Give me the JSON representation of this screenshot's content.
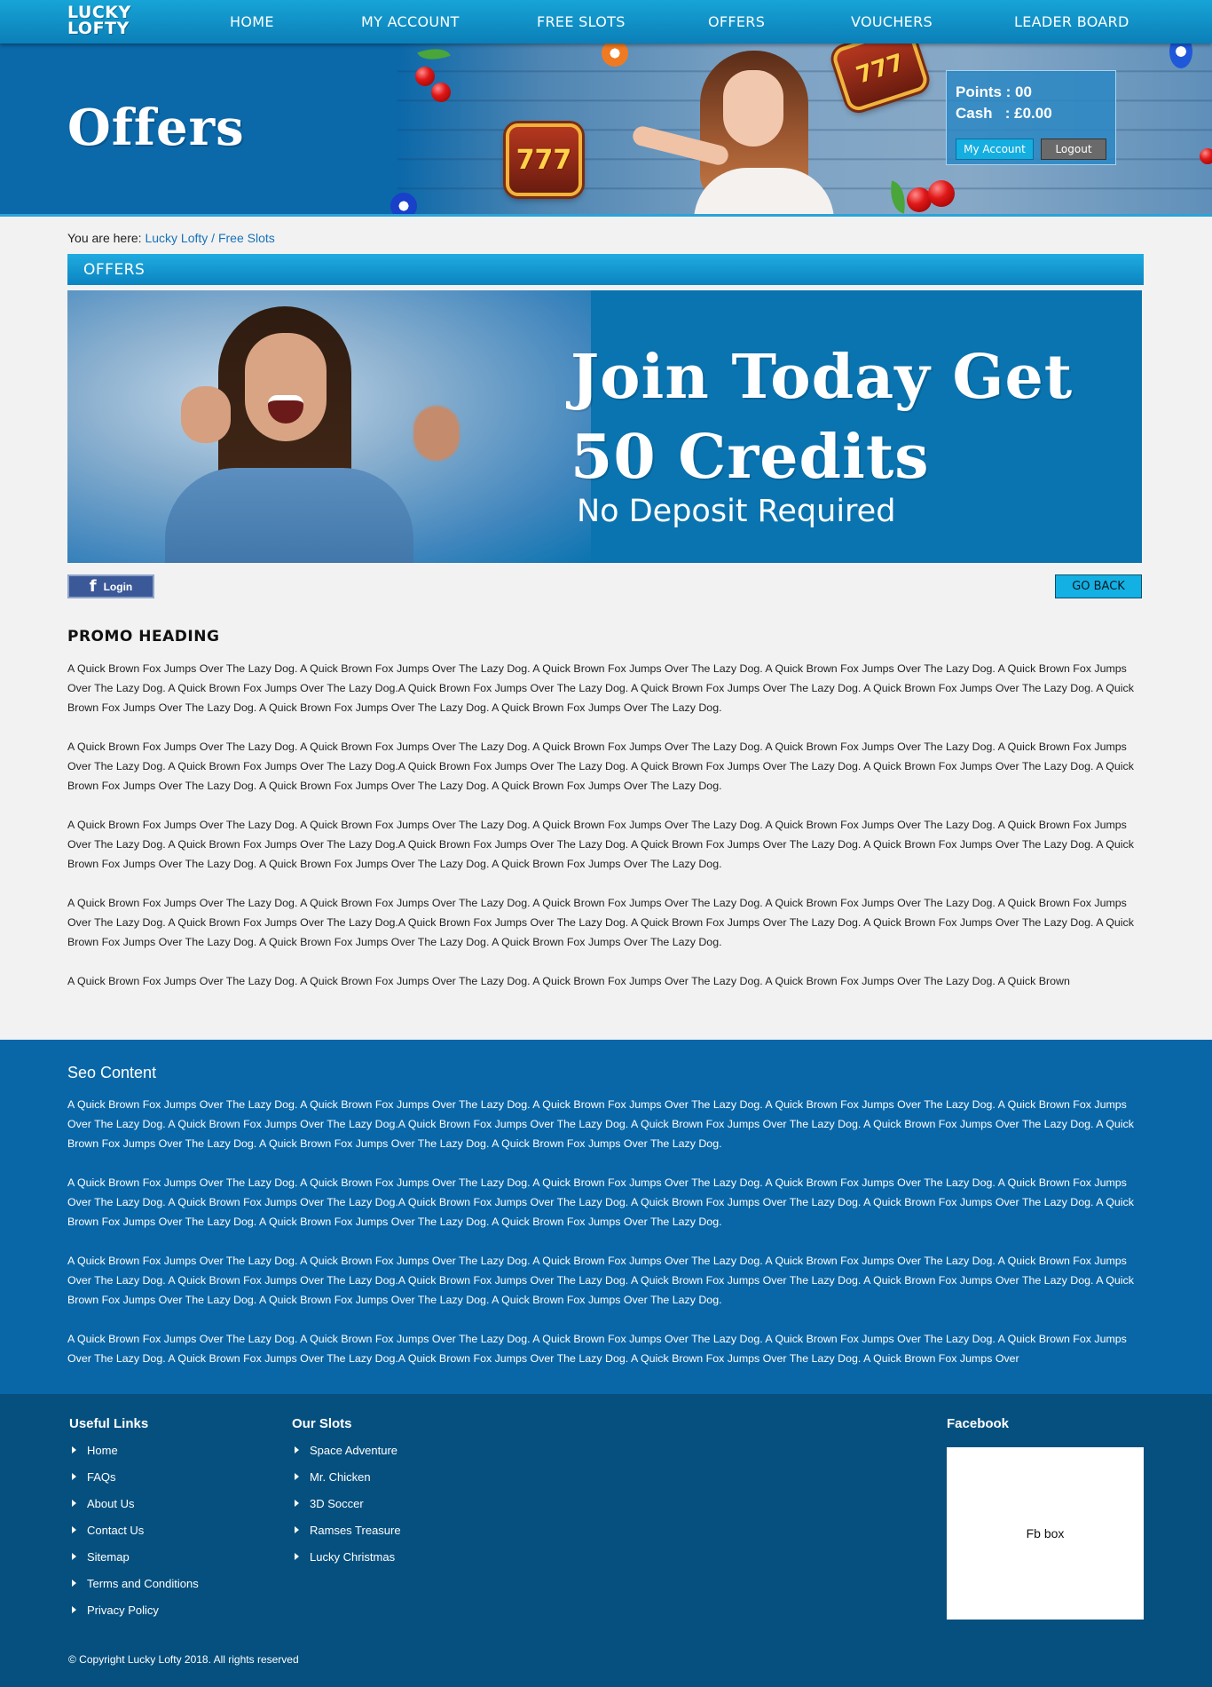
{
  "brand": {
    "logo_line1": "LUCKY",
    "logo_line2": "LOFTY"
  },
  "nav": {
    "items": [
      {
        "label": "HOME"
      },
      {
        "label": "MY ACCOUNT"
      },
      {
        "label": "FREE SLOTS"
      },
      {
        "label": "OFFERS"
      },
      {
        "label": "VOUCHERS"
      },
      {
        "label": "LEADER BOARD"
      }
    ]
  },
  "hero": {
    "title": "Offers",
    "slot_symbol": "777"
  },
  "account": {
    "points_label": "Points : 00",
    "cash_label": "Cash   : £0.00",
    "my_account_button": "My Account",
    "logout_button": "Logout"
  },
  "breadcrumb": {
    "prefix": "You are here: ",
    "items": [
      {
        "label": "Lucky Lofty"
      },
      {
        "label": "Free Slots"
      }
    ],
    "separator": " / "
  },
  "section": {
    "title": "OFFERS"
  },
  "banner": {
    "line1": "Join Today Get",
    "line2": "50 Credits",
    "line3": "No Deposit Required"
  },
  "actions": {
    "fb_icon": "f",
    "fb_login": "Login",
    "go_back": "GO BACK"
  },
  "promo": {
    "heading": "PROMO HEADING",
    "paragraphs": [
      "A Quick Brown Fox Jumps Over The Lazy Dog. A Quick Brown Fox Jumps Over The Lazy Dog. A Quick Brown Fox Jumps Over The Lazy Dog. A Quick Brown Fox Jumps Over The Lazy Dog. A Quick Brown Fox Jumps Over The Lazy Dog. A Quick Brown Fox Jumps Over The Lazy Dog.A Quick Brown Fox Jumps Over The Lazy Dog. A Quick Brown Fox Jumps Over The Lazy Dog. A Quick Brown Fox Jumps Over The Lazy Dog. A Quick Brown Fox Jumps Over The Lazy Dog. A Quick Brown Fox Jumps Over The Lazy Dog. A Quick Brown Fox Jumps Over The Lazy Dog.",
      "A Quick Brown Fox Jumps Over The Lazy Dog. A Quick Brown Fox Jumps Over The Lazy Dog. A Quick Brown Fox Jumps Over The Lazy Dog. A Quick Brown Fox Jumps Over The Lazy Dog. A Quick Brown Fox Jumps Over The Lazy Dog. A Quick Brown Fox Jumps Over The Lazy Dog.A Quick Brown Fox Jumps Over The Lazy Dog. A Quick Brown Fox Jumps Over The Lazy Dog. A Quick Brown Fox Jumps Over The Lazy Dog. A Quick Brown Fox Jumps Over The Lazy Dog. A Quick Brown Fox Jumps Over The Lazy Dog. A Quick Brown Fox Jumps Over The Lazy Dog.",
      "A Quick Brown Fox Jumps Over The Lazy Dog. A Quick Brown Fox Jumps Over The Lazy Dog. A Quick Brown Fox Jumps Over The Lazy Dog. A Quick Brown Fox Jumps Over The Lazy Dog. A Quick Brown Fox Jumps Over The Lazy Dog. A Quick Brown Fox Jumps Over The Lazy Dog.A Quick Brown Fox Jumps Over The Lazy Dog. A Quick Brown Fox Jumps Over The Lazy Dog. A Quick Brown Fox Jumps Over The Lazy Dog. A Quick Brown Fox Jumps Over The Lazy Dog. A Quick Brown Fox Jumps Over The Lazy Dog. A Quick Brown Fox Jumps Over The Lazy Dog.",
      "A Quick Brown Fox Jumps Over The Lazy Dog. A Quick Brown Fox Jumps Over The Lazy Dog. A Quick Brown Fox Jumps Over The Lazy Dog. A Quick Brown Fox Jumps Over The Lazy Dog. A Quick Brown Fox Jumps Over The Lazy Dog. A Quick Brown Fox Jumps Over The Lazy Dog.A Quick Brown Fox Jumps Over The Lazy Dog. A Quick Brown Fox Jumps Over The Lazy Dog. A Quick Brown Fox Jumps Over The Lazy Dog. A Quick Brown Fox Jumps Over The Lazy Dog. A Quick Brown Fox Jumps Over The Lazy Dog. A Quick Brown Fox Jumps Over The Lazy Dog.",
      "A Quick Brown Fox Jumps Over The Lazy Dog. A Quick Brown Fox Jumps Over The Lazy Dog. A Quick Brown Fox Jumps Over The Lazy Dog. A Quick Brown Fox Jumps Over The Lazy Dog. A Quick Brown"
    ]
  },
  "seo": {
    "title": "Seo Content",
    "paragraphs": [
      "A Quick Brown Fox Jumps Over The Lazy Dog. A Quick Brown Fox Jumps Over The Lazy Dog. A Quick Brown Fox Jumps Over The Lazy Dog. A Quick Brown Fox Jumps Over The Lazy Dog. A Quick Brown Fox Jumps Over The Lazy Dog. A Quick Brown Fox Jumps Over The Lazy Dog.A Quick Brown Fox Jumps Over The Lazy Dog. A Quick Brown Fox Jumps Over The Lazy Dog. A Quick Brown Fox Jumps Over The Lazy Dog. A Quick Brown Fox Jumps Over The Lazy Dog. A Quick Brown Fox Jumps Over The Lazy Dog. A Quick Brown Fox Jumps Over The Lazy Dog.",
      "A Quick Brown Fox Jumps Over The Lazy Dog. A Quick Brown Fox Jumps Over The Lazy Dog. A Quick Brown Fox Jumps Over The Lazy Dog. A Quick Brown Fox Jumps Over The Lazy Dog. A Quick Brown Fox Jumps Over The Lazy Dog. A Quick Brown Fox Jumps Over The Lazy Dog.A Quick Brown Fox Jumps Over The Lazy Dog. A Quick Brown Fox Jumps Over The Lazy Dog. A Quick Brown Fox Jumps Over The Lazy Dog. A Quick Brown Fox Jumps Over The Lazy Dog. A Quick Brown Fox Jumps Over The Lazy Dog. A Quick Brown Fox Jumps Over The Lazy Dog.",
      "A Quick Brown Fox Jumps Over The Lazy Dog. A Quick Brown Fox Jumps Over The Lazy Dog. A Quick Brown Fox Jumps Over The Lazy Dog. A Quick Brown Fox Jumps Over The Lazy Dog. A Quick Brown Fox Jumps Over The Lazy Dog. A Quick Brown Fox Jumps Over The Lazy Dog.A Quick Brown Fox Jumps Over The Lazy Dog. A Quick Brown Fox Jumps Over The Lazy Dog. A Quick Brown Fox Jumps Over The Lazy Dog. A Quick Brown Fox Jumps Over The Lazy Dog. A Quick Brown Fox Jumps Over The Lazy Dog. A Quick Brown Fox Jumps Over The Lazy Dog.",
      "A Quick Brown Fox Jumps Over The Lazy Dog. A Quick Brown Fox Jumps Over The Lazy Dog. A Quick Brown Fox Jumps Over The Lazy Dog. A Quick Brown Fox Jumps Over The Lazy Dog. A Quick Brown Fox Jumps Over The Lazy Dog. A Quick Brown Fox Jumps Over The Lazy Dog.A Quick Brown Fox Jumps Over The Lazy Dog. A Quick Brown Fox Jumps Over The Lazy Dog. A Quick Brown Fox Jumps Over"
    ]
  },
  "footer": {
    "useful_links": {
      "title": "Useful Links",
      "items": [
        {
          "label": "Home"
        },
        {
          "label": "FAQs"
        },
        {
          "label": "About Us"
        },
        {
          "label": "Contact Us"
        },
        {
          "label": "Sitemap"
        },
        {
          "label": "Terms and Conditions"
        },
        {
          "label": "Privacy Policy"
        }
      ]
    },
    "our_slots": {
      "title": "Our Slots",
      "items": [
        {
          "label": "Space Adventure"
        },
        {
          "label": "Mr. Chicken"
        },
        {
          "label": "3D Soccer"
        },
        {
          "label": "Ramses Treasure"
        },
        {
          "label": "Lucky Christmas"
        }
      ]
    },
    "facebook": {
      "title": "Facebook",
      "box_label": "Fb box"
    },
    "copyright": "© Copyright Lucky Lofty 2018. All rights reserved"
  },
  "colors": {
    "nav_top": "#17a4d6",
    "hero_blue": "#0b68a9",
    "banner_blue": "#0a74b0",
    "seo_blue": "#0967a8",
    "footer_blue": "#06507f",
    "link_blue": "#1872b8",
    "go_back_cyan": "#13b0e3",
    "facebook_blue": "#3b5998"
  }
}
